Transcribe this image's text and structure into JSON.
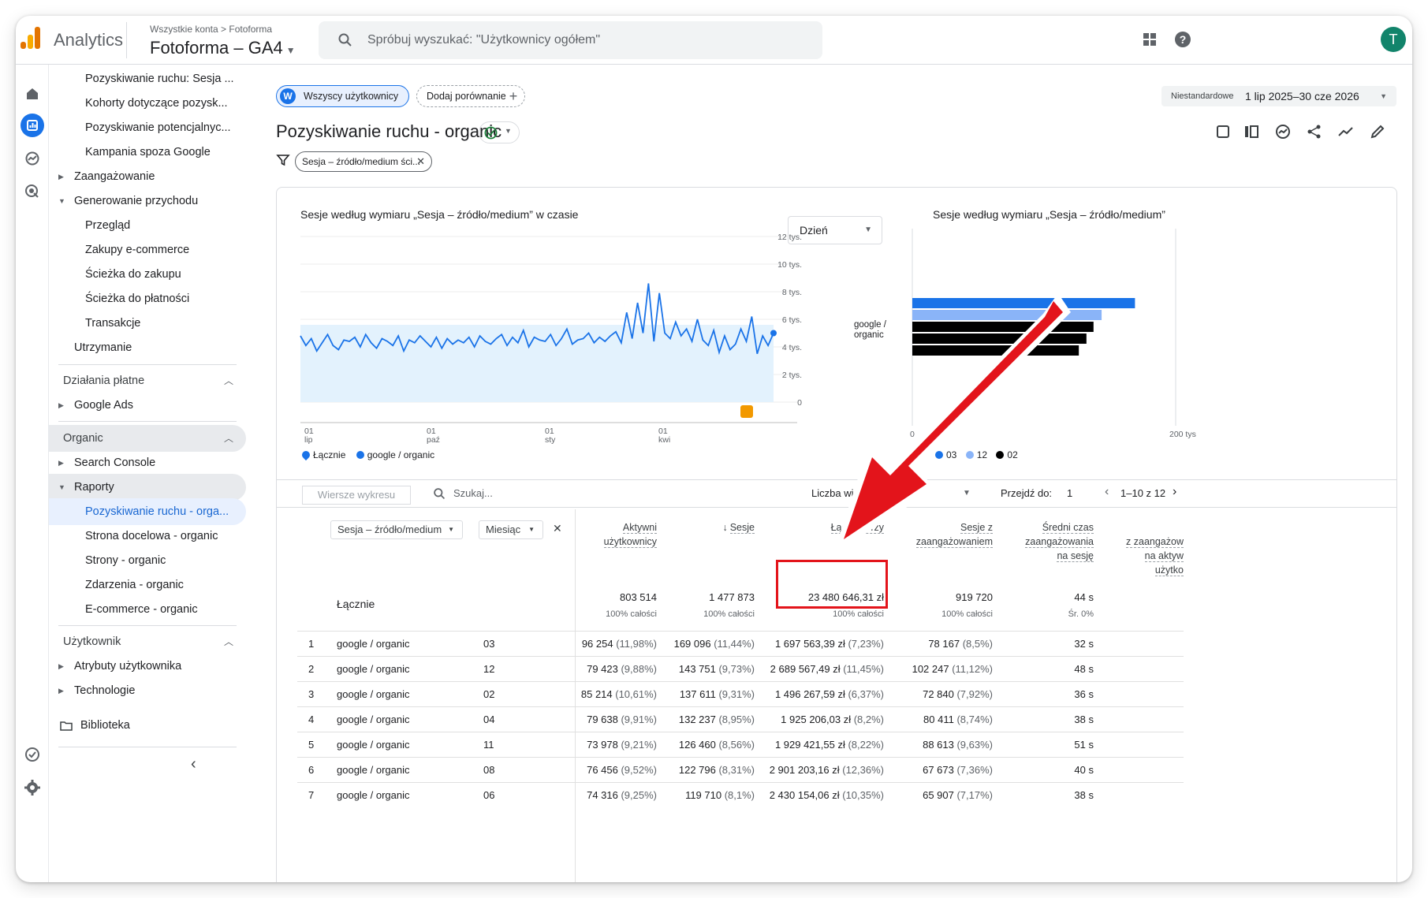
{
  "header": {
    "app_name": "Analytics",
    "breadcrumb": "Wszystkie konta > Fotoforma",
    "property": "Fotoforma – GA4",
    "search_placeholder": "Spróbuj wyszukać: \"Użytkownicy ogółem\"",
    "avatar_letter": "T"
  },
  "sidebar": {
    "items": [
      {
        "label": "Pozyskiwanie ruchu: Sesja ...",
        "level": 2
      },
      {
        "label": "Kohorty dotyczące pozysk...",
        "level": 2
      },
      {
        "label": "Pozyskiwanie potencjalnyc...",
        "level": 2
      },
      {
        "label": "Kampania spoza Google",
        "level": 2
      },
      {
        "label": "Zaangażowanie",
        "level": 1,
        "arrow": "collapsed"
      },
      {
        "label": "Generowanie przychodu",
        "level": 1,
        "arrow": "expanded"
      },
      {
        "label": "Przegląd",
        "level": 2
      },
      {
        "label": "Zakupy e-commerce",
        "level": 2
      },
      {
        "label": "Ścieżka do zakupu",
        "level": 2
      },
      {
        "label": "Ścieżka do płatności",
        "level": 2
      },
      {
        "label": "Transakcje",
        "level": 2
      },
      {
        "label": "Utrzymanie",
        "level": 1
      }
    ],
    "paid_group": "Działania płatne",
    "google_ads": "Google Ads",
    "organic_group": "Organic",
    "search_console": "Search Console",
    "reports": "Raporty",
    "organic_items": [
      "Pozyskiwanie ruchu - orga...",
      "Strona docelowa - organic",
      "Strony - organic",
      "Zdarzenia - organic",
      "E-commerce - organic"
    ],
    "user_group": "Użytkownik",
    "user_attrs": "Atrybuty użytkownika",
    "tech": "Technologie",
    "library": "Biblioteka"
  },
  "toolbar": {
    "segment_chip": "Wszyscy użytkownicy",
    "segment_letter": "W",
    "add_comparison": "Dodaj porównanie",
    "date_label": "Niestandardowe",
    "date_range": "1 lip 2025–30 cze 2026"
  },
  "report": {
    "title": "Pozyskiwanie ruchu - organic",
    "filter_chip": "Sesja – źródło/medium ści..."
  },
  "line_chart": {
    "title": "Sesje według wymiaru „Sesja – źródło/medium” w czasie",
    "granularity": "Dzień",
    "legend": [
      "Łącznie",
      "google / organic"
    ]
  },
  "bar_chart": {
    "title": "Sesje według wymiaru „Sesja – źródło/medium”",
    "category_label_1": "google /",
    "category_label_2": "organic",
    "x_min_label": "0",
    "x_max_label": "200 tys",
    "legend": [
      "03",
      "12",
      "02"
    ]
  },
  "chart_data": [
    {
      "type": "line",
      "title": "Sesje według wymiaru „Sesja – źródło/medium” w czasie",
      "y_ticks": [
        "12 tys.",
        "10 tys.",
        "8 tys.",
        "6 tys.",
        "4 tys.",
        "2 tys.",
        "0"
      ],
      "ylim": [
        0,
        12000
      ],
      "x_ticks": [
        [
          "01",
          "lip"
        ],
        [
          "01",
          "paź"
        ],
        [
          "01",
          "sty"
        ],
        [
          "01",
          "kwi"
        ]
      ],
      "series": [
        {
          "name": "google / organic",
          "color": "#1a73e8",
          "values": [
            4800,
            4100,
            4600,
            3700,
            4300,
            4900,
            4100,
            3800,
            4500,
            4400,
            4700,
            4000,
            4900,
            4300,
            3900,
            4600,
            4400,
            4100,
            4800,
            3700,
            4500,
            4300,
            4800,
            4400,
            4000,
            4700,
            3900,
            4600,
            4200,
            4500,
            4300,
            4700,
            4000,
            4800,
            4400,
            4200,
            4600,
            4900,
            4100,
            4700,
            4300,
            5200,
            4000,
            4700,
            4500,
            4400,
            4900,
            4100,
            4600,
            5300,
            4200,
            4500,
            4600,
            5000,
            4300,
            4700,
            4400,
            4800,
            5100,
            4300,
            6500,
            4600,
            7200,
            5000,
            8600,
            4400,
            7900,
            5000,
            4600,
            5800,
            4800,
            5300,
            4400,
            6000,
            4500,
            4100,
            5200,
            3600,
            4800,
            3800,
            4200,
            5300,
            4400,
            6200,
            3500,
            4800,
            4100,
            5000
          ]
        }
      ],
      "area_series": {
        "name": "Łącznie",
        "color": "#e3f2fd"
      }
    },
    {
      "type": "bar",
      "title": "Sesje według wymiaru „Sesja – źródło/medium”",
      "categories": [
        "google / organic"
      ],
      "xlim": [
        0,
        200000
      ],
      "series": [
        {
          "name": "03",
          "values": [
            169096
          ],
          "color": "#1a73e8"
        },
        {
          "name": "12",
          "values": [
            143751
          ],
          "color": "#8ab4f8"
        },
        {
          "name": "02",
          "values": [
            137611
          ],
          "color": "#000000"
        },
        {
          "name": "04",
          "values": [
            132237
          ],
          "color": "#000000"
        },
        {
          "name": "11",
          "values": [
            126460
          ],
          "color": "#000000"
        }
      ]
    }
  ],
  "table_bar": {
    "rows_placeholder": "Wiersze wykresu",
    "search_placeholder": "Szukaj...",
    "rows_per_page_label": "Liczba wierszy",
    "goto_label": "Przejdź do:",
    "goto_value": "1",
    "pager": "1–10 z 12"
  },
  "table": {
    "dim1": "Sesja – źródło/medium",
    "dim2": "Miesiąc",
    "totals_label": "Łącznie",
    "headers": [
      [
        "Aktywni",
        "użytkownicy"
      ],
      [
        "Sesje"
      ],
      [
        "Łączne przy"
      ],
      [
        "Sesje z",
        "zaangażowaniem"
      ],
      [
        "Średni czas",
        "zaangażowania",
        "na sesję"
      ],
      [
        "z zaangażow",
        "na aktyw",
        "użytko"
      ]
    ],
    "totals": [
      {
        "value": "803 514",
        "sub": "100% całości"
      },
      {
        "value": "1 477 873",
        "sub": "100% całości"
      },
      {
        "value": "23 480 646,31 zł",
        "sub": "100% całości"
      },
      {
        "value": "919 720",
        "sub": "100% całości"
      },
      {
        "value": "44 s",
        "sub": "Śr. 0%"
      }
    ],
    "rows": [
      {
        "n": "1",
        "source": "google / organic",
        "month": "03",
        "users": "96 254",
        "users_p": "(11,98%)",
        "sessions": "169 096",
        "sessions_p": "(11,44%)",
        "revenue": "1 697 563,39 zł",
        "revenue_p": "(7,23%)",
        "eng": "78 167",
        "eng_p": "(8,5%)",
        "time": "32 s"
      },
      {
        "n": "2",
        "source": "google / organic",
        "month": "12",
        "users": "79 423",
        "users_p": "(9,88%)",
        "sessions": "143 751",
        "sessions_p": "(9,73%)",
        "revenue": "2 689 567,49 zł",
        "revenue_p": "(11,45%)",
        "eng": "102 247",
        "eng_p": "(11,12%)",
        "time": "48 s"
      },
      {
        "n": "3",
        "source": "google / organic",
        "month": "02",
        "users": "85 214",
        "users_p": "(10,61%)",
        "sessions": "137 611",
        "sessions_p": "(9,31%)",
        "revenue": "1 496 267,59 zł",
        "revenue_p": "(6,37%)",
        "eng": "72 840",
        "eng_p": "(7,92%)",
        "time": "36 s"
      },
      {
        "n": "4",
        "source": "google / organic",
        "month": "04",
        "users": "79 638",
        "users_p": "(9,91%)",
        "sessions": "132 237",
        "sessions_p": "(8,95%)",
        "revenue": "1 925 206,03 zł",
        "revenue_p": "(8,2%)",
        "eng": "80 411",
        "eng_p": "(8,74%)",
        "time": "38 s"
      },
      {
        "n": "5",
        "source": "google / organic",
        "month": "11",
        "users": "73 978",
        "users_p": "(9,21%)",
        "sessions": "126 460",
        "sessions_p": "(8,56%)",
        "revenue": "1 929 421,55 zł",
        "revenue_p": "(8,22%)",
        "eng": "88 613",
        "eng_p": "(9,63%)",
        "time": "51 s"
      },
      {
        "n": "6",
        "source": "google / organic",
        "month": "08",
        "users": "76 456",
        "users_p": "(9,52%)",
        "sessions": "122 796",
        "sessions_p": "(8,31%)",
        "revenue": "2 901 203,16 zł",
        "revenue_p": "(12,36%)",
        "eng": "67 673",
        "eng_p": "(7,36%)",
        "time": "40 s"
      },
      {
        "n": "7",
        "source": "google / organic",
        "month": "06",
        "users": "74 316",
        "users_p": "(9,25%)",
        "sessions": "119 710",
        "sessions_p": "(8,1%)",
        "revenue": "2 430 154,06 zł",
        "revenue_p": "(10,35%)",
        "eng": "65 907",
        "eng_p": "(7,17%)",
        "time": "38 s"
      }
    ]
  },
  "colors": {
    "accent": "#1a73e8",
    "annotation": "#e3141b"
  }
}
